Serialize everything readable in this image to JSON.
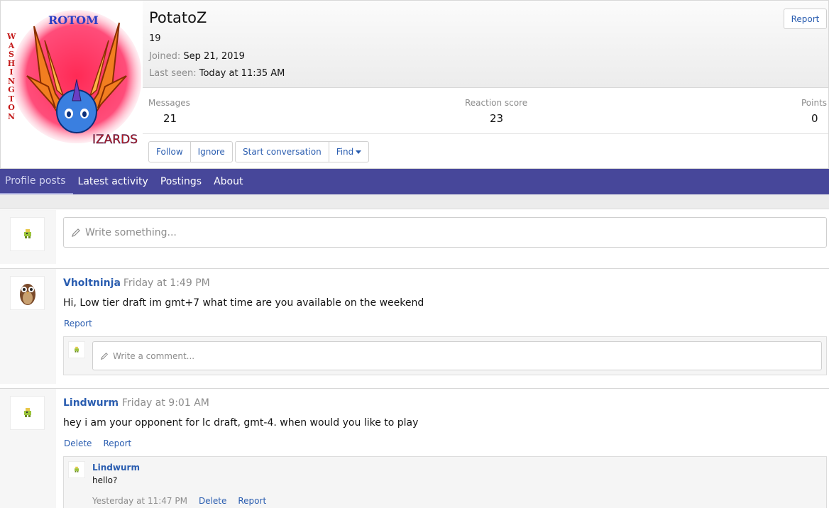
{
  "profile": {
    "username": "PotatoZ",
    "user_title": "19",
    "joined_label": "Joined:",
    "joined_value": "Sep 21, 2019",
    "last_seen_label": "Last seen:",
    "last_seen_value": "Today at 11:35 AM",
    "report_label": "Report",
    "avatar_text_top": "ROTOM",
    "avatar_text_side": "WASHINGTON",
    "avatar_text_bottom": "IZARDS",
    "stats": {
      "messages_label": "Messages",
      "messages_value": "21",
      "reaction_label": "Reaction score",
      "reaction_value": "23",
      "points_label": "Points",
      "points_value": "0"
    },
    "buttons": {
      "follow": "Follow",
      "ignore": "Ignore",
      "start_conversation": "Start conversation",
      "find": "Find"
    }
  },
  "tabs": [
    "Profile posts",
    "Latest activity",
    "Postings",
    "About"
  ],
  "composer": {
    "placeholder": "Write something..."
  },
  "posts": [
    {
      "author": "Vholtninja",
      "time": "· Friday at 1:49 PM",
      "text": "Hi, Low tier draft im gmt+7 what time are you available on the weekend",
      "actions": [
        "Report"
      ],
      "comment_placeholder": "Write a comment..."
    },
    {
      "author": "Lindwurm",
      "time": "· Friday at 9:01 AM",
      "text": "hey i am your opponent for lc draft, gmt-4. when would you like to play",
      "actions": [
        "Delete",
        "Report"
      ],
      "comment": {
        "author": "Lindwurm",
        "text": "hello?",
        "time": "Yesterday at 11:47 PM",
        "actions": [
          "Delete",
          "Report"
        ]
      }
    }
  ],
  "colors": {
    "nav": "#47479a",
    "link": "#2a5db0",
    "muted": "#8c8c8c"
  }
}
